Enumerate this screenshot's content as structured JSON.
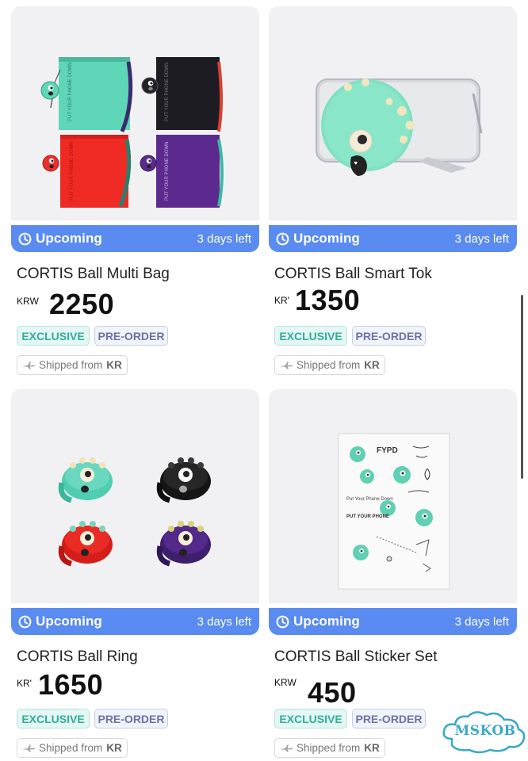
{
  "products": [
    {
      "name": "CORTIS Ball Multi Bag",
      "image": "multi-bag-image",
      "status": "Upcoming",
      "days_left": "3 days left",
      "currency": "KRW",
      "price": "2250",
      "tags": [
        "EXCLUSIVE",
        "PRE-ORDER"
      ],
      "shipped_prefix": "Shipped from",
      "shipped_country": "KR"
    },
    {
      "name": "CORTIS Ball Smart Tok",
      "image": "smart-tok-image",
      "status": "Upcoming",
      "days_left": "3 days left",
      "currency": "KR'",
      "price": "1350",
      "tags": [
        "EXCLUSIVE",
        "PRE-ORDER"
      ],
      "shipped_prefix": "Shipped from",
      "shipped_country": "KR"
    },
    {
      "name": "CORTIS Ball Ring",
      "image": "ring-image",
      "status": "Upcoming",
      "days_left": "3 days left",
      "currency": "KR'",
      "price": "1650",
      "tags": [
        "EXCLUSIVE",
        "PRE-ORDER"
      ],
      "shipped_prefix": "Shipped from",
      "shipped_country": "KR"
    },
    {
      "name": "CORTIS Ball Sticker Set",
      "image": "sticker-set-image",
      "status": "Upcoming",
      "days_left": "3 days left",
      "currency": "KRW",
      "price": "450",
      "tags": [
        "EXCLUSIVE",
        "PRE-ORDER"
      ],
      "shipped_prefix": "Shipped from",
      "shipped_country": "KR"
    }
  ],
  "bag_print": "PUT YOUR PHONE DOWN",
  "sticker_texts": [
    "FYPD",
    "PUT YOUR PHONE",
    "Put Your Phone Down",
    "PUT YOUR PHONE"
  ],
  "watermark": "MSKOB",
  "colors": {
    "status_bar": "#5a8bf0",
    "exclusive_text": "#2fae9a",
    "preorder_text": "#6874a6",
    "mint": "#5fd0b3"
  }
}
